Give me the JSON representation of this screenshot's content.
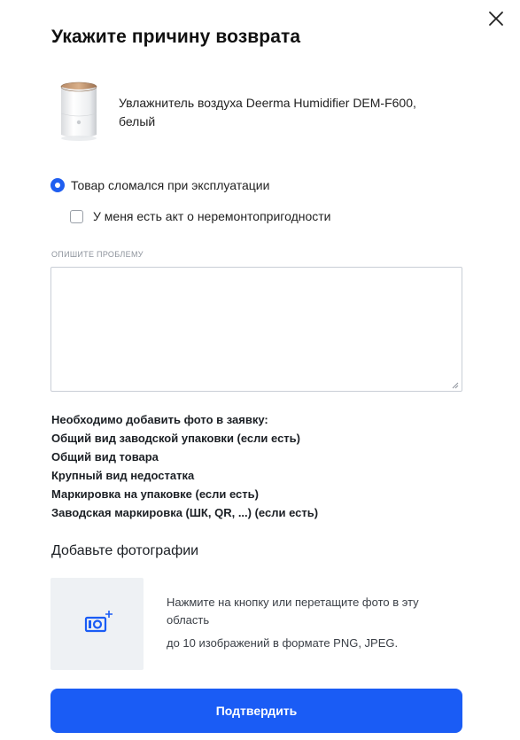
{
  "dialog": {
    "title": "Укажите причину возврата",
    "close_icon": "close-icon"
  },
  "product": {
    "name": "Увлажнитель воздуха Deerma Humidifier DEM-F600, белый",
    "image_icon": "humidifier-image"
  },
  "reason": {
    "label": "Товар сломался при эксплуатации",
    "selected": true
  },
  "certificate": {
    "label": "У меня есть акт о неремонтопригодности",
    "checked": false
  },
  "problem": {
    "label": "ОПИШИТЕ ПРОБЛЕМУ",
    "value": ""
  },
  "requirements": {
    "heading": "Необходимо добавить фото в заявку:",
    "items": [
      "Общий вид заводской упаковки (если есть)",
      "Общий вид товара",
      "Крупный вид недостатка",
      "Маркировка на упаковке (если есть)",
      "Заводская маркировка (ШК, QR, ...) (если есть)"
    ]
  },
  "photos": {
    "title": "Добавьте фотографии",
    "hint": "Нажмите на кнопку или перетащите фото в эту область",
    "limit": "до 10 изображений в формате PNG, JPEG.",
    "icon": "add-photo-icon"
  },
  "submit": {
    "label": "Подтвердить"
  },
  "colors": {
    "accent": "#1a5cf5",
    "upload_bg": "#eef1f4"
  }
}
